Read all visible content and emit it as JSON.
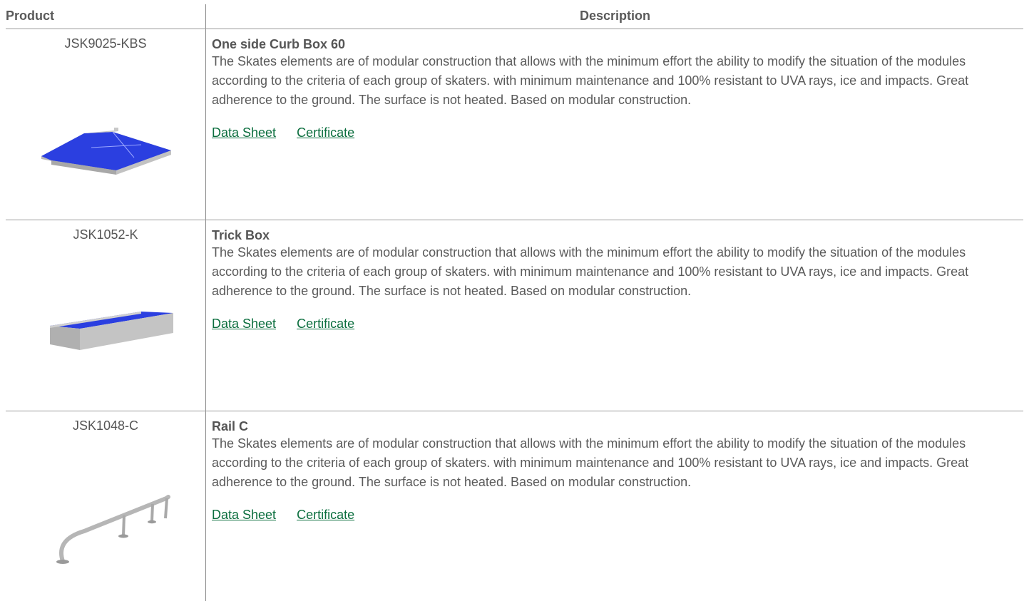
{
  "header": {
    "product_label": "Product",
    "description_label": "Description"
  },
  "products": [
    {
      "code": "JSK9025-KBS",
      "name": "One side Curb Box 60",
      "description": "The Skates elements are of modular construction that allows with the minimum effort the ability to modify the situation of the modules according to the criteria of each group of skaters. with minimum maintenance and 100% resistant to UVA rays, ice and impacts. Great adherence to the ground. The surface is not heated. Based on modular construction.",
      "data_sheet_label": "Data Sheet",
      "certificate_label": "Certificate",
      "image": "curb-box-image"
    },
    {
      "code": "JSK1052-K",
      "name": "Trick Box",
      "description": "The Skates elements are of modular construction that allows with the minimum effort the ability to modify the situation of the modules according to the criteria of each group of skaters. with minimum maintenance and 100% resistant to UVA rays, ice and impacts. Great adherence to the ground. The surface is not heated. Based on modular construction.",
      "data_sheet_label": "Data Sheet",
      "certificate_label": "Certificate",
      "image": "trick-box-image"
    },
    {
      "code": "JSK1048-C",
      "name": "Rail C",
      "description": "The Skates elements are of modular construction that allows with the minimum effort the ability to modify the situation of the modules according to the criteria of each group of skaters. with minimum maintenance and 100% resistant to UVA rays, ice and impacts. Great adherence to the ground. The surface is not heated. Based on modular construction.",
      "data_sheet_label": "Data Sheet",
      "certificate_label": "Certificate",
      "image": "rail-image"
    }
  ],
  "colors": {
    "link": "#0b6e3e",
    "text": "#555555",
    "product_blue": "#2b3fe0",
    "product_grey": "#b9b9b9"
  }
}
